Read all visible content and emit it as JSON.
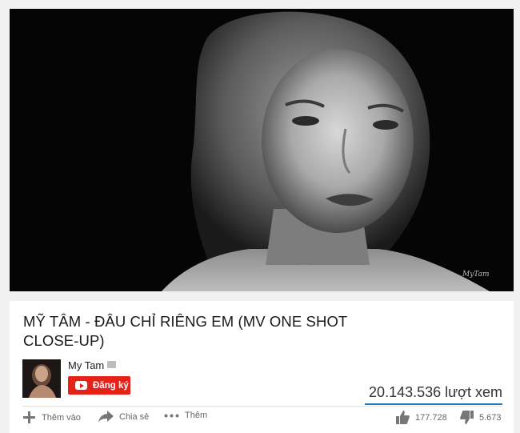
{
  "video": {
    "watermark": "MyTam"
  },
  "title": "MỸ TÂM - ĐÂU CHỈ RIÊNG EM (MV ONE SHOT CLOSE-UP)",
  "channel": {
    "name": "My Tam",
    "subscribe_label": "Đăng ký"
  },
  "views": "20.143.536 lượt xem",
  "actions": {
    "add_to": "Thêm vào",
    "share": "Chia sẻ",
    "more": "Thêm"
  },
  "likes": "177.728",
  "dislikes": "5.673",
  "colors": {
    "subscribe": "#e62117",
    "view_bar": "#167ac6"
  }
}
